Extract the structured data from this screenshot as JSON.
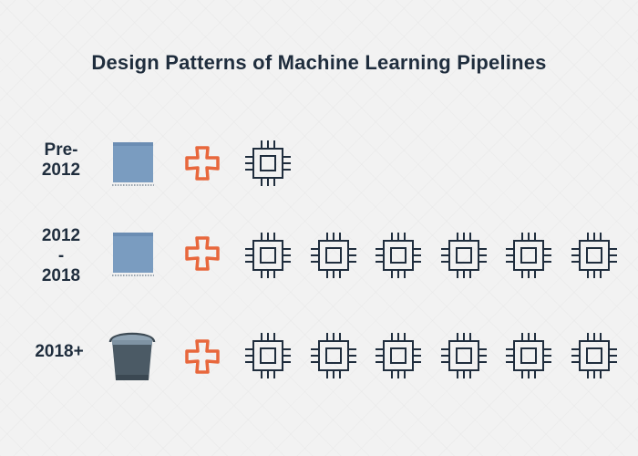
{
  "title": "Design Patterns of Machine Learning Pipelines",
  "colors": {
    "text": "#1f2d3d",
    "plus": "#e8673c",
    "chip": "#1f2d3d",
    "floppy": "#7a9cc0",
    "bucket": "#4b5a65"
  },
  "rows": [
    {
      "label_lines": [
        "Pre-",
        "2012"
      ],
      "storage_icon": "floppy-disk-icon",
      "chip_count": 1
    },
    {
      "label_lines": [
        "2012",
        "-",
        "2018"
      ],
      "storage_icon": "floppy-disk-icon",
      "chip_count": 6
    },
    {
      "label_lines": [
        "2018+"
      ],
      "storage_icon": "bucket-icon",
      "chip_count": 6
    }
  ]
}
